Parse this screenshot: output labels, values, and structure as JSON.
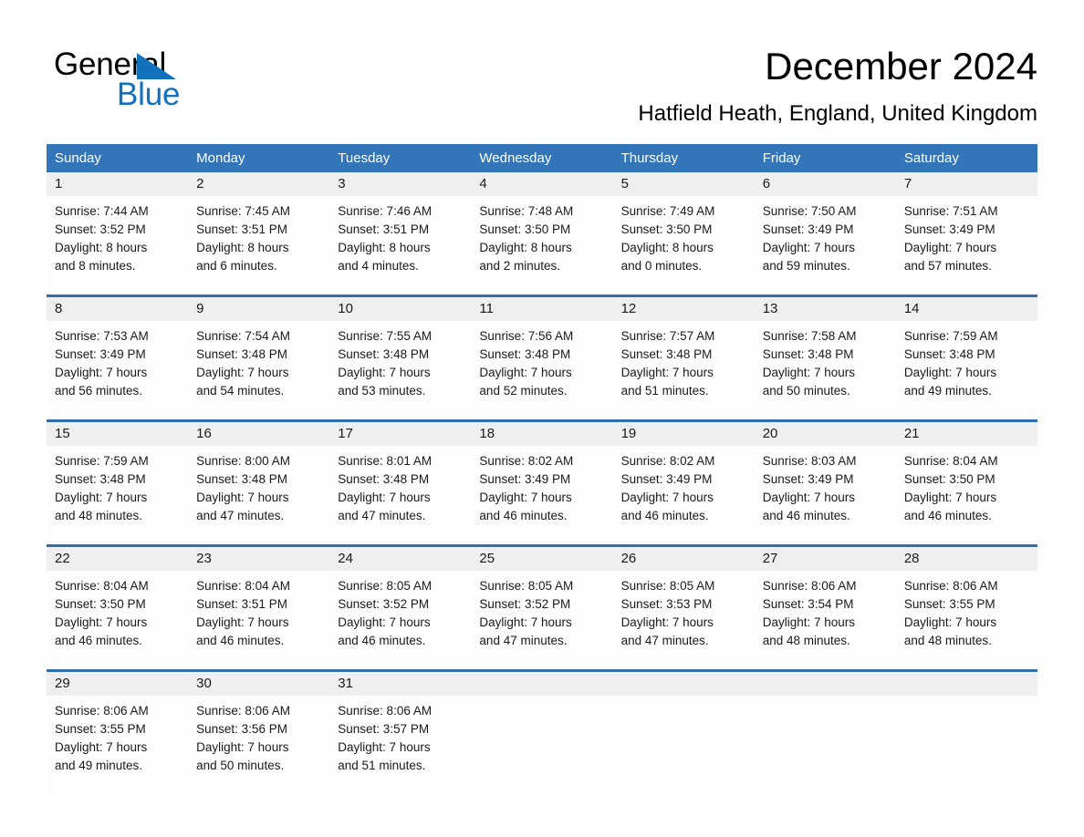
{
  "brand": {
    "name_dark": "General",
    "name_light": "Blue",
    "triangle_color": "#1271bd",
    "accent_color": "#3275b8"
  },
  "header": {
    "title": "December 2024",
    "subtitle": "Hatfield Heath, England, United Kingdom"
  },
  "calendar": {
    "weekday_headers": [
      "Sunday",
      "Monday",
      "Tuesday",
      "Wednesday",
      "Thursday",
      "Friday",
      "Saturday"
    ],
    "weeks": [
      {
        "days": [
          {
            "num": "1",
            "sunrise": "Sunrise: 7:44 AM",
            "sunset": "Sunset: 3:52 PM",
            "daylight_1": "Daylight: 8 hours",
            "daylight_2": "and 8 minutes."
          },
          {
            "num": "2",
            "sunrise": "Sunrise: 7:45 AM",
            "sunset": "Sunset: 3:51 PM",
            "daylight_1": "Daylight: 8 hours",
            "daylight_2": "and 6 minutes."
          },
          {
            "num": "3",
            "sunrise": "Sunrise: 7:46 AM",
            "sunset": "Sunset: 3:51 PM",
            "daylight_1": "Daylight: 8 hours",
            "daylight_2": "and 4 minutes."
          },
          {
            "num": "4",
            "sunrise": "Sunrise: 7:48 AM",
            "sunset": "Sunset: 3:50 PM",
            "daylight_1": "Daylight: 8 hours",
            "daylight_2": "and 2 minutes."
          },
          {
            "num": "5",
            "sunrise": "Sunrise: 7:49 AM",
            "sunset": "Sunset: 3:50 PM",
            "daylight_1": "Daylight: 8 hours",
            "daylight_2": "and 0 minutes."
          },
          {
            "num": "6",
            "sunrise": "Sunrise: 7:50 AM",
            "sunset": "Sunset: 3:49 PM",
            "daylight_1": "Daylight: 7 hours",
            "daylight_2": "and 59 minutes."
          },
          {
            "num": "7",
            "sunrise": "Sunrise: 7:51 AM",
            "sunset": "Sunset: 3:49 PM",
            "daylight_1": "Daylight: 7 hours",
            "daylight_2": "and 57 minutes."
          }
        ]
      },
      {
        "days": [
          {
            "num": "8",
            "sunrise": "Sunrise: 7:53 AM",
            "sunset": "Sunset: 3:49 PM",
            "daylight_1": "Daylight: 7 hours",
            "daylight_2": "and 56 minutes."
          },
          {
            "num": "9",
            "sunrise": "Sunrise: 7:54 AM",
            "sunset": "Sunset: 3:48 PM",
            "daylight_1": "Daylight: 7 hours",
            "daylight_2": "and 54 minutes."
          },
          {
            "num": "10",
            "sunrise": "Sunrise: 7:55 AM",
            "sunset": "Sunset: 3:48 PM",
            "daylight_1": "Daylight: 7 hours",
            "daylight_2": "and 53 minutes."
          },
          {
            "num": "11",
            "sunrise": "Sunrise: 7:56 AM",
            "sunset": "Sunset: 3:48 PM",
            "daylight_1": "Daylight: 7 hours",
            "daylight_2": "and 52 minutes."
          },
          {
            "num": "12",
            "sunrise": "Sunrise: 7:57 AM",
            "sunset": "Sunset: 3:48 PM",
            "daylight_1": "Daylight: 7 hours",
            "daylight_2": "and 51 minutes."
          },
          {
            "num": "13",
            "sunrise": "Sunrise: 7:58 AM",
            "sunset": "Sunset: 3:48 PM",
            "daylight_1": "Daylight: 7 hours",
            "daylight_2": "and 50 minutes."
          },
          {
            "num": "14",
            "sunrise": "Sunrise: 7:59 AM",
            "sunset": "Sunset: 3:48 PM",
            "daylight_1": "Daylight: 7 hours",
            "daylight_2": "and 49 minutes."
          }
        ]
      },
      {
        "days": [
          {
            "num": "15",
            "sunrise": "Sunrise: 7:59 AM",
            "sunset": "Sunset: 3:48 PM",
            "daylight_1": "Daylight: 7 hours",
            "daylight_2": "and 48 minutes."
          },
          {
            "num": "16",
            "sunrise": "Sunrise: 8:00 AM",
            "sunset": "Sunset: 3:48 PM",
            "daylight_1": "Daylight: 7 hours",
            "daylight_2": "and 47 minutes."
          },
          {
            "num": "17",
            "sunrise": "Sunrise: 8:01 AM",
            "sunset": "Sunset: 3:48 PM",
            "daylight_1": "Daylight: 7 hours",
            "daylight_2": "and 47 minutes."
          },
          {
            "num": "18",
            "sunrise": "Sunrise: 8:02 AM",
            "sunset": "Sunset: 3:49 PM",
            "daylight_1": "Daylight: 7 hours",
            "daylight_2": "and 46 minutes."
          },
          {
            "num": "19",
            "sunrise": "Sunrise: 8:02 AM",
            "sunset": "Sunset: 3:49 PM",
            "daylight_1": "Daylight: 7 hours",
            "daylight_2": "and 46 minutes."
          },
          {
            "num": "20",
            "sunrise": "Sunrise: 8:03 AM",
            "sunset": "Sunset: 3:49 PM",
            "daylight_1": "Daylight: 7 hours",
            "daylight_2": "and 46 minutes."
          },
          {
            "num": "21",
            "sunrise": "Sunrise: 8:04 AM",
            "sunset": "Sunset: 3:50 PM",
            "daylight_1": "Daylight: 7 hours",
            "daylight_2": "and 46 minutes."
          }
        ]
      },
      {
        "days": [
          {
            "num": "22",
            "sunrise": "Sunrise: 8:04 AM",
            "sunset": "Sunset: 3:50 PM",
            "daylight_1": "Daylight: 7 hours",
            "daylight_2": "and 46 minutes."
          },
          {
            "num": "23",
            "sunrise": "Sunrise: 8:04 AM",
            "sunset": "Sunset: 3:51 PM",
            "daylight_1": "Daylight: 7 hours",
            "daylight_2": "and 46 minutes."
          },
          {
            "num": "24",
            "sunrise": "Sunrise: 8:05 AM",
            "sunset": "Sunset: 3:52 PM",
            "daylight_1": "Daylight: 7 hours",
            "daylight_2": "and 46 minutes."
          },
          {
            "num": "25",
            "sunrise": "Sunrise: 8:05 AM",
            "sunset": "Sunset: 3:52 PM",
            "daylight_1": "Daylight: 7 hours",
            "daylight_2": "and 47 minutes."
          },
          {
            "num": "26",
            "sunrise": "Sunrise: 8:05 AM",
            "sunset": "Sunset: 3:53 PM",
            "daylight_1": "Daylight: 7 hours",
            "daylight_2": "and 47 minutes."
          },
          {
            "num": "27",
            "sunrise": "Sunrise: 8:06 AM",
            "sunset": "Sunset: 3:54 PM",
            "daylight_1": "Daylight: 7 hours",
            "daylight_2": "and 48 minutes."
          },
          {
            "num": "28",
            "sunrise": "Sunrise: 8:06 AM",
            "sunset": "Sunset: 3:55 PM",
            "daylight_1": "Daylight: 7 hours",
            "daylight_2": "and 48 minutes."
          }
        ]
      },
      {
        "days": [
          {
            "num": "29",
            "sunrise": "Sunrise: 8:06 AM",
            "sunset": "Sunset: 3:55 PM",
            "daylight_1": "Daylight: 7 hours",
            "daylight_2": "and 49 minutes."
          },
          {
            "num": "30",
            "sunrise": "Sunrise: 8:06 AM",
            "sunset": "Sunset: 3:56 PM",
            "daylight_1": "Daylight: 7 hours",
            "daylight_2": "and 50 minutes."
          },
          {
            "num": "31",
            "sunrise": "Sunrise: 8:06 AM",
            "sunset": "Sunset: 3:57 PM",
            "daylight_1": "Daylight: 7 hours",
            "daylight_2": "and 51 minutes."
          },
          {
            "num": "",
            "sunrise": "",
            "sunset": "",
            "daylight_1": "",
            "daylight_2": ""
          },
          {
            "num": "",
            "sunrise": "",
            "sunset": "",
            "daylight_1": "",
            "daylight_2": ""
          },
          {
            "num": "",
            "sunrise": "",
            "sunset": "",
            "daylight_1": "",
            "daylight_2": ""
          },
          {
            "num": "",
            "sunrise": "",
            "sunset": "",
            "daylight_1": "",
            "daylight_2": ""
          }
        ]
      }
    ]
  }
}
